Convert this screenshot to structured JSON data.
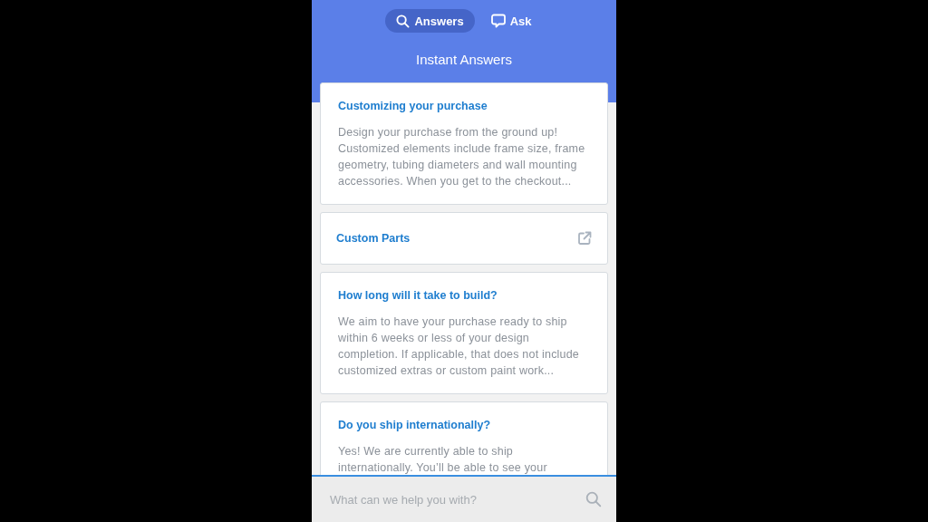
{
  "tabs": [
    {
      "label": "Answers",
      "kind": "search",
      "selected": true
    },
    {
      "label": "Ask",
      "kind": "chat",
      "selected": false
    }
  ],
  "title": "Instant Answers",
  "cards": [
    {
      "kind": "article",
      "title": "Customizing your purchase",
      "body": "Design your purchase from the ground up! Customized elements include frame size, frame geometry, tubing diameters and wall mounting accessories. When you get to the checkout..."
    },
    {
      "kind": "link",
      "title": "Custom Parts"
    },
    {
      "kind": "article",
      "title": "How long will it take to build?",
      "body": "We aim to have your purchase ready to ship within 6 weeks or less of your design completion. If applicable, that does not include customized extras or custom paint work..."
    },
    {
      "kind": "article",
      "title": "Do you ship internationally?",
      "body": "Yes! We are currently able to ship internationally. You’ll be able to see your"
    }
  ],
  "search": {
    "placeholder": "What can we help you with?"
  }
}
